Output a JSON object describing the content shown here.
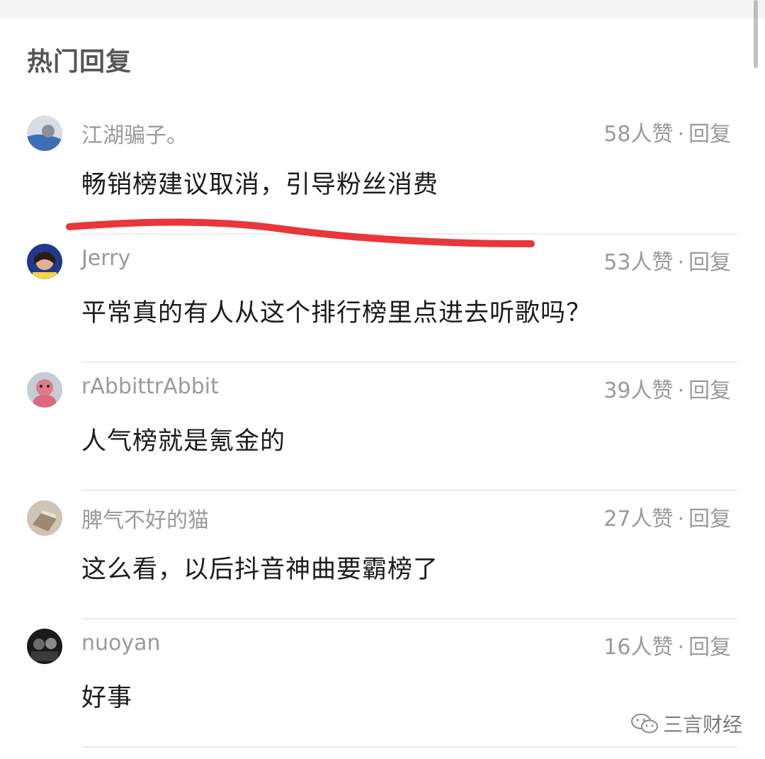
{
  "section": {
    "title": "热门回复"
  },
  "comments": [
    {
      "username": "江湖骗子。",
      "likes": "58人赞",
      "reply_label": "回复",
      "text": "畅销榜建议取消，引导粉丝消费",
      "avatar": "avatar-photo"
    },
    {
      "username": "Jerry",
      "likes": "53人赞",
      "reply_label": "回复",
      "text": "平常真的有人从这个排行榜里点进去听歌吗？",
      "avatar": "avatar-photo"
    },
    {
      "username": "rAbbittrAbbit",
      "likes": "39人赞",
      "reply_label": "回复",
      "text": "人气榜就是氪金的",
      "avatar": "avatar-photo"
    },
    {
      "username": "脾气不好的猫",
      "likes": "27人赞",
      "reply_label": "回复",
      "text": "这么看，以后抖音神曲要霸榜了",
      "avatar": "avatar-photo"
    },
    {
      "username": "nuoyan",
      "likes": "16人赞",
      "reply_label": "回复",
      "text": "好事",
      "avatar": "avatar-photo"
    }
  ],
  "meta_separator": "·",
  "watermark": {
    "text": "三言财经",
    "icon": "wechat-icon"
  },
  "colors": {
    "underline": "#e8373a",
    "muted": "#9a9a9a",
    "text": "#1c1c1c"
  }
}
